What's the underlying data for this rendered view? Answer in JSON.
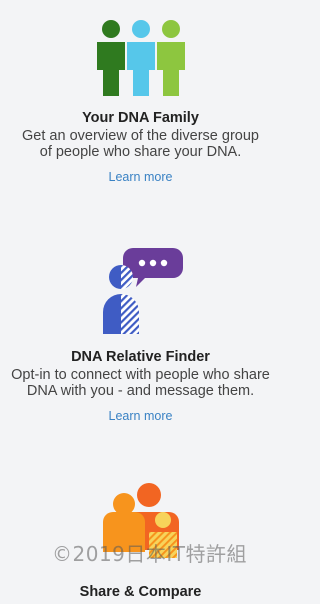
{
  "features": [
    {
      "title": "Your DNA Family",
      "description": "Get an overview of the diverse group of people who share your DNA.",
      "link": "Learn more"
    },
    {
      "title": "DNA Relative Finder",
      "description": "Opt-in to connect with people who share DNA with you - and message them.",
      "link": "Learn more"
    },
    {
      "title": "Share & Compare"
    }
  ],
  "watermark": "©2019日本IT特許組",
  "colors": {
    "green_dark": "#2f7a1f",
    "blue_light": "#56c7ea",
    "green_light": "#8dc63f",
    "purple": "#6a3d9a",
    "blue": "#3f5cc4",
    "orange": "#f26522",
    "orange_light": "#f7941d",
    "yellow": "#f7d35a",
    "link": "#3a82c4"
  },
  "icons": [
    "family-group-icon",
    "relative-finder-chat-icon",
    "share-compare-icon"
  ]
}
